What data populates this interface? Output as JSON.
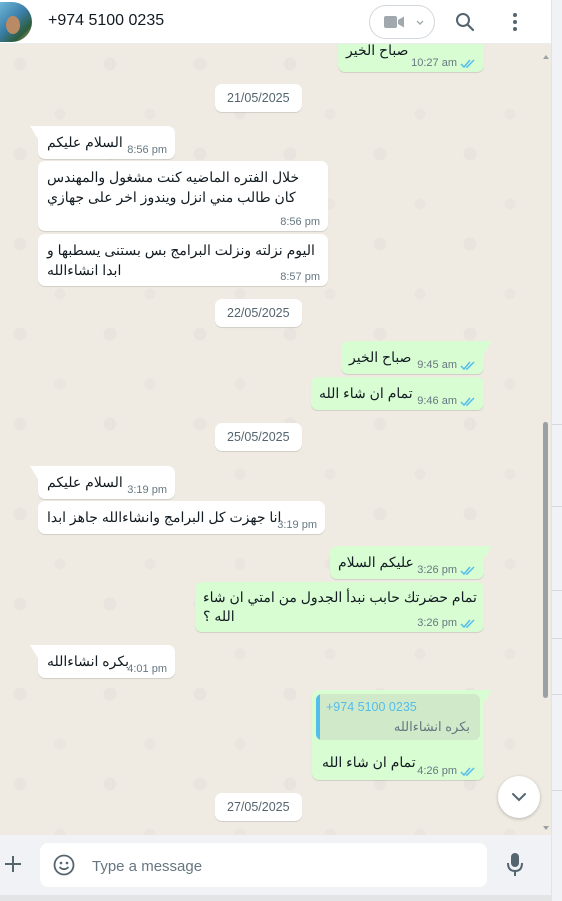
{
  "header": {
    "contact_name": "+974 5100 0235",
    "video_icon": "video-camera-icon",
    "dropdown_icon": "chevron-down-icon",
    "search_icon": "search-icon",
    "menu_icon": "more-vertical-icon"
  },
  "colors": {
    "outgoing_bubble": "#d9fdd3",
    "incoming_bubble": "#ffffff",
    "chat_background": "#efeae2",
    "read_ticks": "#53bdeb"
  },
  "messages": {
    "m0": {
      "text": "صباح الخير",
      "time": "10:27 am"
    },
    "date1": "21/05/2025",
    "m1": {
      "text": "السلام عليكم",
      "time": "8:56 pm"
    },
    "m2": {
      "line1": "خلال الفتره الماضيه كنت مشغول والمهندس",
      "line2": "كان طالب مني انزل ويندوز اخر على جهازي",
      "time": "8:56 pm"
    },
    "m3": {
      "line1": "اليوم نزلته ونزلت البرامج بس بستنى يسطبها و",
      "line2": "ابدا انشاءالله",
      "time": "8:57 pm"
    },
    "date2": "22/05/2025",
    "m4": {
      "text": "صباح الخير",
      "time": "9:45 am"
    },
    "m5": {
      "text": "تمام ان  شاء الله",
      "time": "9:46 am"
    },
    "date3": "25/05/2025",
    "m6": {
      "text": "السلام عليكم",
      "time": "3:19 pm"
    },
    "m7": {
      "text": "انا جهزت كل البرامج وانشاءالله جاهز ابدا",
      "time": "3:19 pm"
    },
    "m8": {
      "text": "عليكم السلام",
      "time": "3:26 pm"
    },
    "m9": {
      "line1": "تمام حضرتك حابب نبدأ الجدول من امتي ان شاء",
      "line2": "الله ؟",
      "time": "3:26 pm"
    },
    "m10": {
      "text": "بكره انشاءالله",
      "time": "4:01 pm"
    },
    "m11": {
      "quote_name": "+974 5100 0235",
      "quote_text": "بكره انشاءالله",
      "text": "تمام ان شاء الله",
      "time": "4:26 pm"
    },
    "date4": "27/05/2025"
  },
  "footer": {
    "plus_icon": "plus-icon",
    "emoji_icon": "emoji-icon",
    "placeholder": "Type a message",
    "mic_icon": "microphone-icon"
  },
  "scroll_down_icon": "chevron-down-icon"
}
